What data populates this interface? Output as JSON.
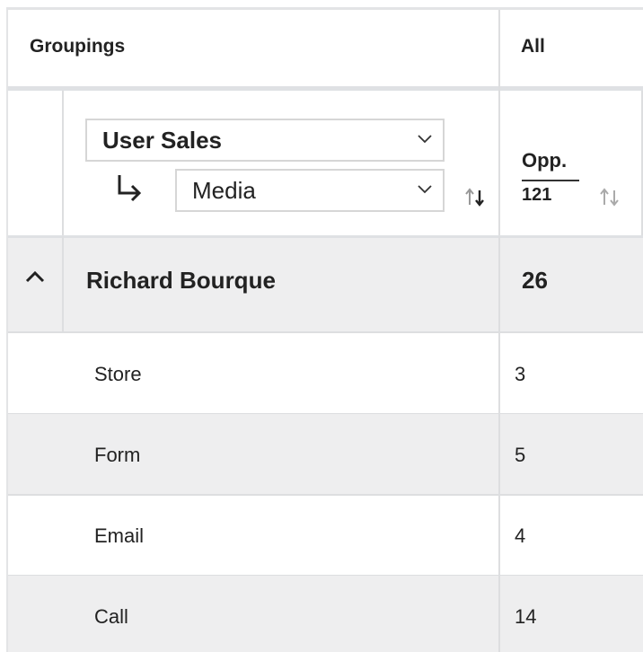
{
  "header": {
    "groupings_title": "Groupings",
    "column_title": "All"
  },
  "controls": {
    "primary_grouping": {
      "value": "User Sales"
    },
    "secondary_grouping": {
      "value": "Media"
    }
  },
  "metric": {
    "label": "Opp.",
    "total": "121"
  },
  "group": {
    "name": "Richard Bourque",
    "count": "26",
    "expanded": true
  },
  "rows": [
    {
      "label": "Store",
      "value": "3"
    },
    {
      "label": "Form",
      "value": "5"
    },
    {
      "label": "Email",
      "value": "4"
    },
    {
      "label": "Call",
      "value": "14"
    }
  ],
  "colors": {
    "border": "#dddee0",
    "stripe": "#eeeeef",
    "text": "#222222"
  },
  "icons": [
    "chevron-down-icon",
    "subgroup-arrow-icon",
    "sort-icon",
    "collapse-caret-icon"
  ]
}
